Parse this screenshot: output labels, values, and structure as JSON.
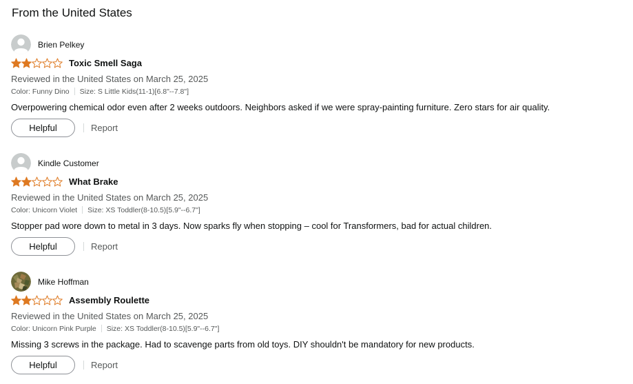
{
  "section": {
    "title": "From the United States"
  },
  "colors": {
    "star_fill": "#DE7921",
    "star_empty_stroke": "#DE7921",
    "text_primary": "#0F1111",
    "text_secondary": "#565959",
    "button_border": "#8D9096"
  },
  "reviews": [
    {
      "reviewer": "Brien Pelkey",
      "avatar": "default-avatar-icon",
      "rating": 2,
      "rating_max": 5,
      "title": "Toxic Smell Saga",
      "date": "Reviewed in the United States on March 25, 2025",
      "color": "Color: Funny Dino",
      "size": "Size: S Little Kids(11-1)[6.8\"--7.8\"]",
      "body": "Overpowering chemical odor even after 2 weeks outdoors. Neighbors asked if we were spray-painting furniture. Zero stars for air quality.",
      "helpful_label": "Helpful",
      "report_label": "Report"
    },
    {
      "reviewer": "Kindle Customer",
      "avatar": "default-avatar-icon",
      "rating": 2,
      "rating_max": 5,
      "title": "What Brake",
      "date": "Reviewed in the United States on March 25, 2025",
      "color": "Color: Unicorn Violet",
      "size": "Size: XS Toddler(8-10.5)[5.9\"--6.7\"]",
      "body": "Stopper pad wore down to metal in 3 days. Now sparks fly when stopping – cool for Transformers, bad for actual children.",
      "helpful_label": "Helpful",
      "report_label": "Report"
    },
    {
      "reviewer": "Mike Hoffman",
      "avatar": "photo-avatar-icon",
      "rating": 2,
      "rating_max": 5,
      "title": "Assembly Roulette",
      "date": "Reviewed in the United States on March 25, 2025",
      "color": "Color: Unicorn Pink Purple",
      "size": "Size: XS Toddler(8-10.5)[5.9\"--6.7\"]",
      "body": "Missing 3 screws in the package. Had to scavenge parts from old toys. DIY shouldn't be mandatory for new products.",
      "helpful_label": "Helpful",
      "report_label": "Report"
    }
  ]
}
